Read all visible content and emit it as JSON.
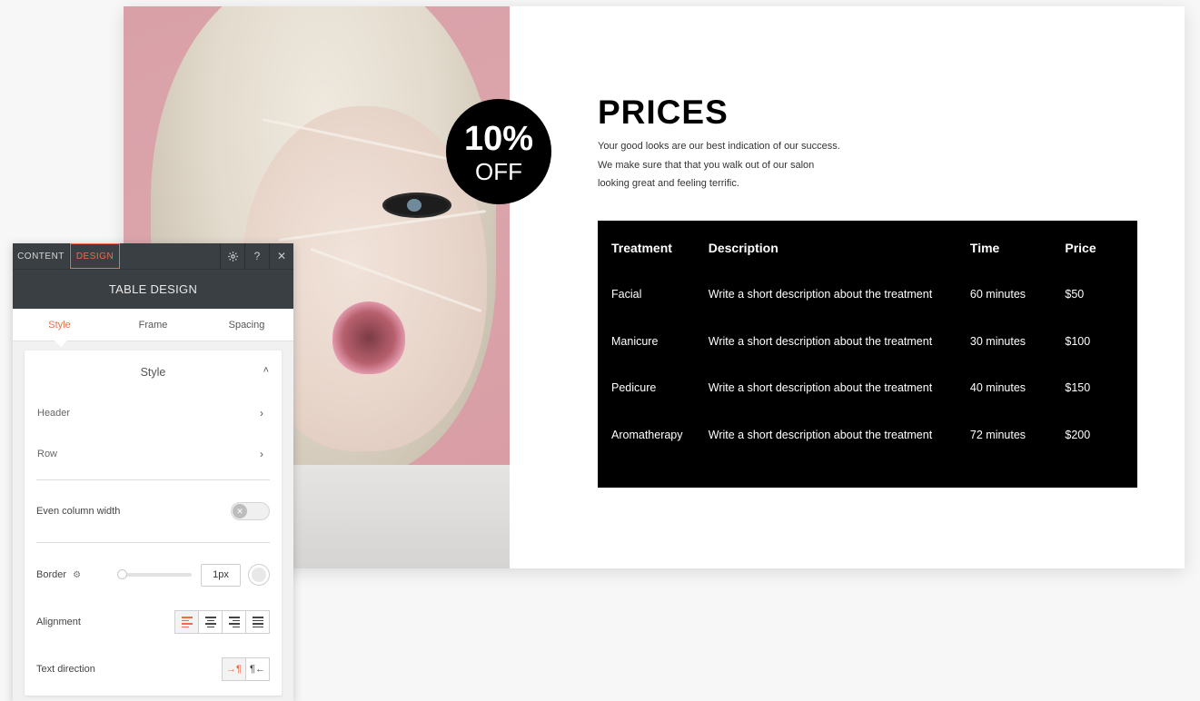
{
  "canvas": {
    "badge": {
      "percent": "10%",
      "off": "OFF"
    },
    "title": "PRICES",
    "description": [
      "Your good looks are our best indication of our success.",
      "We make sure that that you walk out of our salon",
      "looking great and feeling terrific."
    ],
    "table": {
      "headers": [
        "Treatment",
        "Description",
        "Time",
        "Price"
      ],
      "rows": [
        [
          "Facial",
          "Write a short description about the treatment",
          "60 minutes",
          "$50"
        ],
        [
          "Manicure",
          "Write a short description about the treatment",
          "30 minutes",
          "$100"
        ],
        [
          "Pedicure",
          "Write a short description about the treatment",
          "40 minutes",
          "$150"
        ],
        [
          "Aromatherapy",
          "Write a short description about the treatment",
          "72 minutes",
          "$200"
        ]
      ]
    }
  },
  "panel": {
    "tabs": {
      "content": "CONTENT",
      "design": "DESIGN"
    },
    "icons": {
      "settings": "gear-icon",
      "help": "?",
      "close": "✕"
    },
    "title": "TABLE DESIGN",
    "subtabs": [
      "Style",
      "Frame",
      "Spacing"
    ],
    "group": {
      "title": "Style",
      "links": [
        "Header",
        "Row"
      ],
      "even_column_width": "Even column width",
      "border_label": "Border",
      "border_value": "1px",
      "alignment_label": "Alignment",
      "text_direction_label": "Text direction"
    },
    "accent_color": "#ef6b4a"
  }
}
